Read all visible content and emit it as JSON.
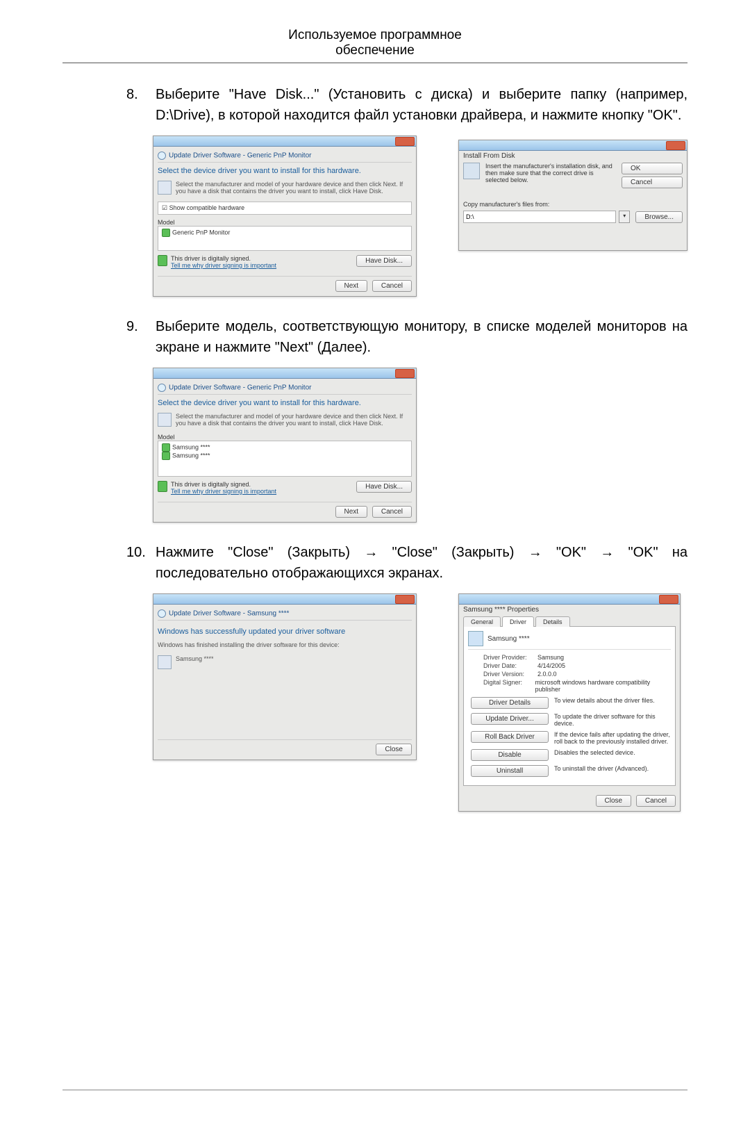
{
  "doc": {
    "header_line1": "Используемое программное",
    "header_line2": "обеспечение"
  },
  "steps": {
    "s8": {
      "num": "8.",
      "text": "Выберите \"Have Disk...\" (Установить с диска) и выберите папку (например, D:\\Drive), в которой находится файл установки драйвера, и нажмите кнопку \"OK\"."
    },
    "s9": {
      "num": "9.",
      "text": "Выберите модель, соответствующую монитору, в списке моделей мониторов на экране и нажмите \"Next\" (Далее)."
    },
    "s10": {
      "num": "10.",
      "text": "Нажмите \"Close\" (Закрыть) → \"Close\" (Закрыть) → \"OK\" → \"OK\" на последовательно отображающихся экранах."
    }
  },
  "wiz8": {
    "crumb": "Update Driver Software - Generic PnP Monitor",
    "heading": "Select the device driver you want to install for this hardware.",
    "instr": "Select the manufacturer and model of your hardware device and then click Next. If you have a disk that contains the driver you want to install, click Have Disk.",
    "compat": "Show compatible hardware",
    "model_label": "Model",
    "model_item": "Generic PnP Monitor",
    "signed": "This driver is digitally signed.",
    "tell": "Tell me why driver signing is important",
    "have_disk": "Have Disk...",
    "next": "Next",
    "cancel": "Cancel"
  },
  "dlg8": {
    "title": "Install From Disk",
    "msg": "Insert the manufacturer's installation disk, and then make sure that the correct drive is selected below.",
    "ok": "OK",
    "cancel": "Cancel",
    "copy": "Copy manufacturer's files from:",
    "path": "D:\\",
    "browse": "Browse..."
  },
  "wiz9": {
    "crumb": "Update Driver Software - Generic PnP Monitor",
    "heading": "Select the device driver you want to install for this hardware.",
    "instr": "Select the manufacturer and model of your hardware device and then click Next. If you have a disk that contains the driver you want to install, click Have Disk.",
    "model_label": "Model",
    "item1": "Samsung ****",
    "item2": "Samsung ****",
    "signed": "This driver is digitally signed.",
    "tell": "Tell me why driver signing is important",
    "have_disk": "Have Disk...",
    "next": "Next",
    "cancel": "Cancel"
  },
  "wiz10a": {
    "crumb": "Update Driver Software - Samsung ****",
    "heading": "Windows has successfully updated your driver software",
    "sub": "Windows has finished installing the driver software for this device:",
    "device": "Samsung ****",
    "close": "Close"
  },
  "props": {
    "title": "Samsung **** Properties",
    "tab_general": "General",
    "tab_driver": "Driver",
    "tab_details": "Details",
    "device": "Samsung ****",
    "provider_k": "Driver Provider:",
    "provider_v": "Samsung",
    "date_k": "Driver Date:",
    "date_v": "4/14/2005",
    "ver_k": "Driver Version:",
    "ver_v": "2.0.0.0",
    "signer_k": "Digital Signer:",
    "signer_v": "microsoft windows hardware compatibility publisher",
    "b_details": "Driver Details",
    "t_details": "To view details about the driver files.",
    "b_update": "Update Driver...",
    "t_update": "To update the driver software for this device.",
    "b_roll": "Roll Back Driver",
    "t_roll": "If the device fails after updating the driver, roll back to the previously installed driver.",
    "b_disable": "Disable",
    "t_disable": "Disables the selected device.",
    "b_uninstall": "Uninstall",
    "t_uninstall": "To uninstall the driver (Advanced).",
    "close": "Close",
    "cancel": "Cancel"
  }
}
